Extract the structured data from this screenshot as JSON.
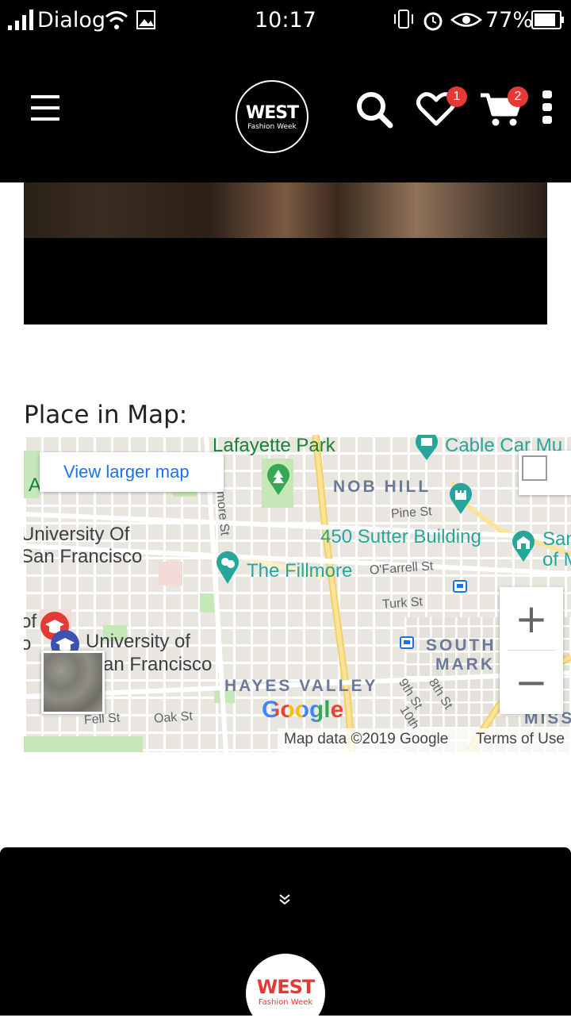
{
  "status_bar": {
    "carrier": "Dialog",
    "time": "10:17",
    "battery": "77%"
  },
  "header": {
    "logo_title": "WEST",
    "logo_subtitle": "Fashion Week",
    "wishlist_count": "1",
    "cart_count": "2",
    "icons": [
      "hamburger-menu-icon",
      "search-icon",
      "heart-icon",
      "cart-icon",
      "kebab-menu-icon"
    ]
  },
  "section": {
    "title": "Place in Map:"
  },
  "map": {
    "view_larger": "View larger map",
    "labels": {
      "lafayette": "Lafayette Park",
      "cable_car": "Cable Car Mu",
      "nob_hill": "NOB HILL",
      "pine_st": "Pine St",
      "univ_sf_1": "University Of",
      "univ_sf_2": "San Francisco",
      "sutter": "450 Sutter Building",
      "san_of_1": "San",
      "san_of_2": "of M",
      "fillmore": "The Fillmore",
      "ofarrell": "O'Farrell St",
      "turk": "Turk St",
      "univ_of_1": "University of",
      "univ_of_2": "an Francisco",
      "south_1": "SOUTH",
      "south_2": "MARK",
      "hayes": "HAYES VALLEY",
      "ninth": "9th St",
      "eighth": "8th St",
      "tenth": "10th",
      "fell": "Fell St",
      "oak": "Oak St",
      "mis": "MISS",
      "fillmore_st": "more St",
      "of_left": "of",
      "o_left": "o",
      "a_left": "A"
    },
    "google": "Google",
    "map_data": "Map data ©2019 Google",
    "terms": "Terms of Use",
    "zoom_in": "+",
    "zoom_out": "−"
  },
  "footer": {
    "expand_icon": "double-chevron-down-icon",
    "logo_title": "WEST",
    "logo_subtitle": "Fashion Week"
  },
  "colors": {
    "accent_red": "#e53935",
    "map_link_blue": "#1a73e8",
    "map_teal": "#26a69a",
    "map_green_text": "#188038"
  }
}
